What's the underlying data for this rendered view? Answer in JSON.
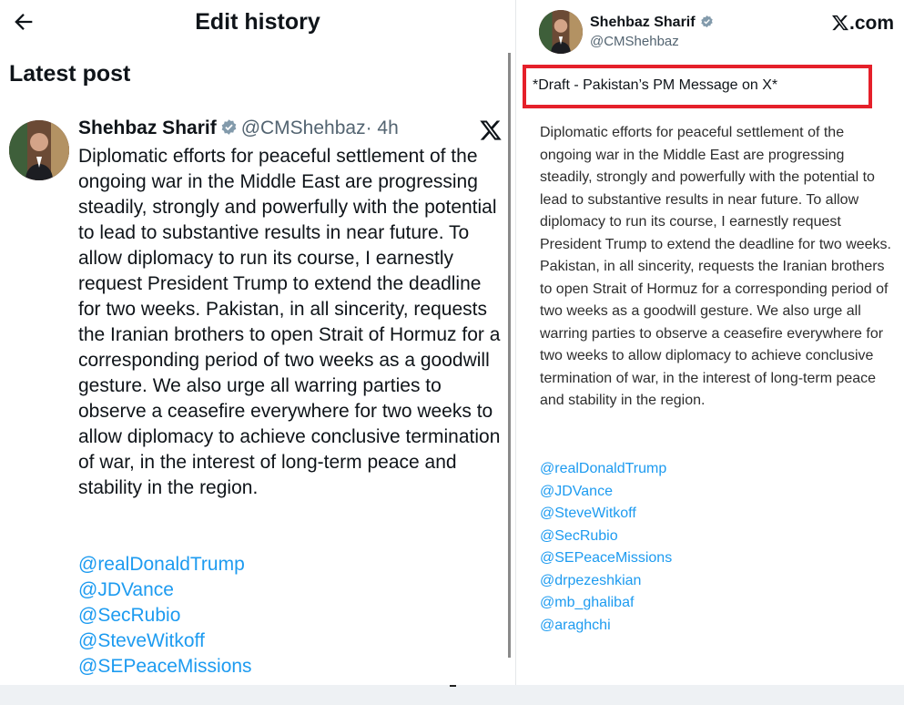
{
  "header": {
    "title": "Edit history"
  },
  "section": {
    "title": "Latest post"
  },
  "post": {
    "name": "Shehbaz Sharif",
    "handle": "@CMShehbaz",
    "time": "· 4h",
    "body": "Diplomatic efforts for peaceful settlement of the ongoing war in the Middle East are progressing steadily, strongly and powerfully with the potential to lead to substantive results in near future. To allow diplomacy to run its course, I earnestly request President Trump to extend the deadline for two weeks. Pakistan, in all sincerity, requests the Iranian brothers to open Strait of Hormuz for a corresponding period of two weeks as a goodwill gesture. We also urge all warring parties to observe a ceasefire everywhere for two weeks to allow diplomacy to achieve conclusive termination of war, in the interest of long-term peace and stability in the region.",
    "mentions": [
      "@realDonaldTrump",
      "@JDVance",
      "@SecRubio",
      "@SteveWitkoff",
      "@SEPeaceMissions"
    ]
  },
  "draft": {
    "name": "Shehbaz Sharif",
    "handle": "@CMShehbaz",
    "brand": ".com",
    "label": "*Draft - Pakistan’s PM Message on X*",
    "body": "Diplomatic efforts for peaceful settlement of the ongoing war in the Middle East are progressing steadily, strongly and powerfully with the potential to lead to substantive results in near future. To allow diplomacy to run its course, I earnestly request President Trump to extend the deadline for two weeks. Pakistan, in all sincerity, requests the Iranian brothers to open Strait of Hormuz for a corresponding period of two weeks as a goodwill gesture. We also urge all warring parties to observe a ceasefire everywhere for two weeks to allow diplomacy to achieve conclusive termination of war, in the interest of long-term peace and stability in the region.",
    "mentions": [
      "@realDonaldTrump",
      "@JDVance",
      "@SteveWitkoff",
      "@SecRubio",
      "@SEPeaceMissions",
      "@drpezeshkian",
      "@mb_ghalibaf",
      "@araghchi"
    ]
  },
  "icons": {
    "back": "arrow-left-icon",
    "verified": "verified-badge-icon",
    "x": "x-logo-icon"
  },
  "colors": {
    "link": "#1d9bf0",
    "verified": "#829aab",
    "highlight": "#e5202a",
    "muted": "#536471"
  }
}
